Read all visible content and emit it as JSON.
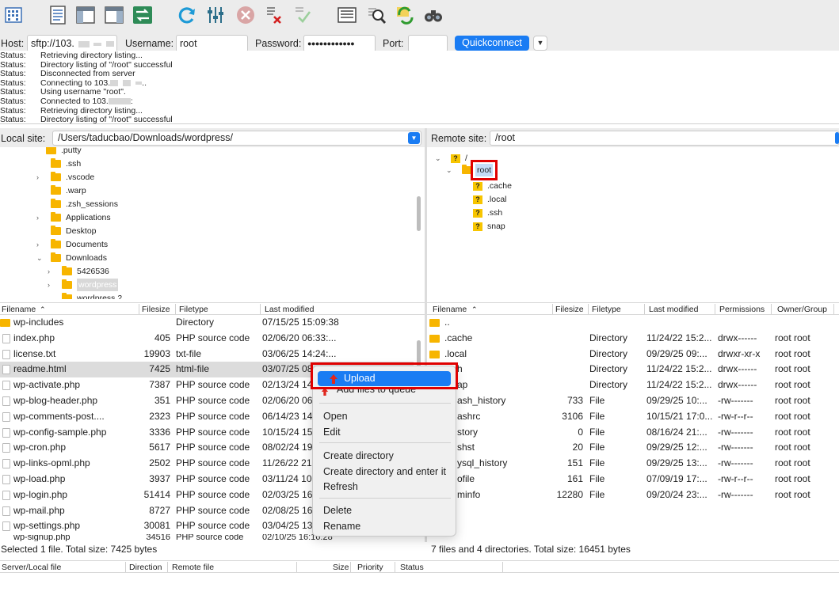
{
  "toolbar": {
    "icons": [
      "site-manager-icon",
      "toggle-log-icon",
      "toggle-local-tree-icon",
      "toggle-remote-tree-icon",
      "transfer-queue-icon",
      "refresh-icon",
      "filter-icon",
      "cancel-icon",
      "disconnect-icon",
      "reconnect-icon",
      "directory-listing-icon",
      "search-icon",
      "sync-browse-icon",
      "find-files-icon"
    ]
  },
  "quickconnect": {
    "host_label": "Host:",
    "host_value": "sftp://103.",
    "username_label": "Username:",
    "username_value": "root",
    "password_label": "Password:",
    "password_value": "●●●●●●●●●●●●",
    "port_label": "Port:",
    "port_value": "",
    "button_label": "Quickconnect",
    "dropdown_glyph": "▼"
  },
  "log": [
    {
      "label": "Status:",
      "text": "Retrieving directory listing..."
    },
    {
      "label": "Status:",
      "text": "Directory listing of \"/root\" successful"
    },
    {
      "label": "Status:",
      "text": "Disconnected from server"
    },
    {
      "label": "Status:",
      "text": "Connecting to 103."
    },
    {
      "label": "Status:",
      "text": "Using username \"root\"."
    },
    {
      "label": "Status:",
      "text": "Connected to 103."
    },
    {
      "label": "Status:",
      "text": "Retrieving directory listing..."
    },
    {
      "label": "Status:",
      "text": "Directory listing of \"/root\" successful"
    }
  ],
  "local": {
    "site_label": "Local site:",
    "site_path": "/Users/taducbao/Downloads/wordpress/",
    "tree": [
      {
        "name": ".putty",
        "arrow": ""
      },
      {
        "name": ".ssh",
        "arrow": ""
      },
      {
        "name": ".vscode",
        "arrow": "›"
      },
      {
        "name": ".warp",
        "arrow": ""
      },
      {
        "name": ".zsh_sessions",
        "arrow": ""
      },
      {
        "name": "Applications",
        "arrow": "›"
      },
      {
        "name": "Desktop",
        "arrow": ""
      },
      {
        "name": "Documents",
        "arrow": "›"
      },
      {
        "name": "Downloads",
        "arrow": "⌄"
      },
      {
        "name": "5426536",
        "arrow": "›"
      },
      {
        "name": "wordpress",
        "arrow": "›"
      },
      {
        "name": "wordpress 2",
        "arrow": ""
      }
    ],
    "headers": {
      "filename": "Filename",
      "filesize": "Filesize",
      "filetype": "Filetype",
      "modified": "Last modified"
    },
    "files": [
      {
        "name": "wp-includes",
        "size": "",
        "type": "Directory",
        "modified": "07/15/25 15:09:38"
      },
      {
        "name": "index.php",
        "size": "405",
        "type": "PHP source code",
        "modified": "02/06/20 06:33:..."
      },
      {
        "name": "license.txt",
        "size": "19903",
        "type": "txt-file",
        "modified": "03/06/25 14:24:..."
      },
      {
        "name": "readme.html",
        "size": "7425",
        "type": "html-file",
        "modified": "03/07/25 08"
      },
      {
        "name": "wp-activate.php",
        "size": "7387",
        "type": "PHP source code",
        "modified": "02/13/24 14"
      },
      {
        "name": "wp-blog-header.php",
        "size": "351",
        "type": "PHP source code",
        "modified": "02/06/20 06"
      },
      {
        "name": "wp-comments-post....",
        "size": "2323",
        "type": "PHP source code",
        "modified": "06/14/23 14"
      },
      {
        "name": "wp-config-sample.php",
        "size": "3336",
        "type": "PHP source code",
        "modified": "10/15/24 15"
      },
      {
        "name": "wp-cron.php",
        "size": "5617",
        "type": "PHP source code",
        "modified": "08/02/24 19"
      },
      {
        "name": "wp-links-opml.php",
        "size": "2502",
        "type": "PHP source code",
        "modified": "11/26/22 21"
      },
      {
        "name": "wp-load.php",
        "size": "3937",
        "type": "PHP source code",
        "modified": "03/11/24 10"
      },
      {
        "name": "wp-login.php",
        "size": "51414",
        "type": "PHP source code",
        "modified": "02/03/25 16"
      },
      {
        "name": "wp-mail.php",
        "size": "8727",
        "type": "PHP source code",
        "modified": "02/08/25 16"
      },
      {
        "name": "wp-settings.php",
        "size": "30081",
        "type": "PHP source code",
        "modified": "03/04/25 13"
      },
      {
        "name": "wp-signup.php",
        "size": "34516",
        "type": "PHP source code",
        "modified": "02/10/25 16:16:28"
      }
    ],
    "status": "Selected 1 file. Total size: 7425 bytes"
  },
  "remote": {
    "site_label": "Remote site:",
    "site_path": "/root",
    "tree": [
      {
        "name": "/",
        "arrow": "⌄"
      },
      {
        "name": "root",
        "arrow": "⌄"
      },
      {
        "name": ".cache",
        "arrow": ""
      },
      {
        "name": ".local",
        "arrow": ""
      },
      {
        "name": ".ssh",
        "arrow": ""
      },
      {
        "name": "snap",
        "arrow": ""
      }
    ],
    "headers": {
      "filename": "Filename",
      "filesize": "Filesize",
      "filetype": "Filetype",
      "modified": "Last modified",
      "permissions": "Permissions",
      "owner": "Owner/Group"
    },
    "files": [
      {
        "name": "..",
        "size": "",
        "type": "",
        "modified": "",
        "perms": "",
        "owner": ""
      },
      {
        "name": ".cache",
        "size": "",
        "type": "Directory",
        "modified": "11/24/22 15:2...",
        "perms": "drwx------",
        "owner": "root root"
      },
      {
        "name": ".local",
        "size": "",
        "type": "Directory",
        "modified": "09/29/25 09:...",
        "perms": "drwxr-xr-x",
        "owner": "root root"
      },
      {
        "name": "h",
        "size": "",
        "type": "Directory",
        "modified": "11/24/22 15:2...",
        "perms": "drwx------",
        "owner": "root root"
      },
      {
        "name": "ap",
        "size": "",
        "type": "Directory",
        "modified": "11/24/22 15:2...",
        "perms": "drwx------",
        "owner": "root root"
      },
      {
        "name": "ash_history",
        "size": "733",
        "type": "File",
        "modified": "09/29/25 10:...",
        "perms": "-rw-------",
        "owner": "root root"
      },
      {
        "name": "ashrc",
        "size": "3106",
        "type": "File",
        "modified": "10/15/21 17:0...",
        "perms": "-rw-r--r--",
        "owner": "root root"
      },
      {
        "name": "story",
        "size": "0",
        "type": "File",
        "modified": "08/16/24 21:...",
        "perms": "-rw-------",
        "owner": "root root"
      },
      {
        "name": "shst",
        "size": "20",
        "type": "File",
        "modified": "09/29/25 12:...",
        "perms": "-rw-------",
        "owner": "root root"
      },
      {
        "name": "ysql_history",
        "size": "151",
        "type": "File",
        "modified": "09/29/25 13:...",
        "perms": "-rw-------",
        "owner": "root root"
      },
      {
        "name": "ofile",
        "size": "161",
        "type": "File",
        "modified": "07/09/19 17:...",
        "perms": "-rw-r--r--",
        "owner": "root root"
      },
      {
        "name": "minfo",
        "size": "12280",
        "type": "File",
        "modified": "09/20/24 23:...",
        "perms": "-rw-------",
        "owner": "root root"
      }
    ],
    "status": "7 files and 4 directories. Total size: 16451 bytes"
  },
  "context_menu": {
    "upload": "Upload",
    "add_to_queue": "Add files to queue",
    "open": "Open",
    "edit": "Edit",
    "create_directory": "Create directory",
    "create_directory_enter": "Create directory and enter it",
    "refresh": "Refresh",
    "delete": "Delete",
    "rename": "Rename"
  },
  "queue": {
    "server_local_file": "Server/Local file",
    "direction": "Direction",
    "remote_file": "Remote file",
    "size": "Size",
    "priority": "Priority",
    "status": "Status"
  },
  "colors": {
    "accent": "#1a7cf3",
    "highlight": "#e00000",
    "folder": "#f7b500"
  }
}
